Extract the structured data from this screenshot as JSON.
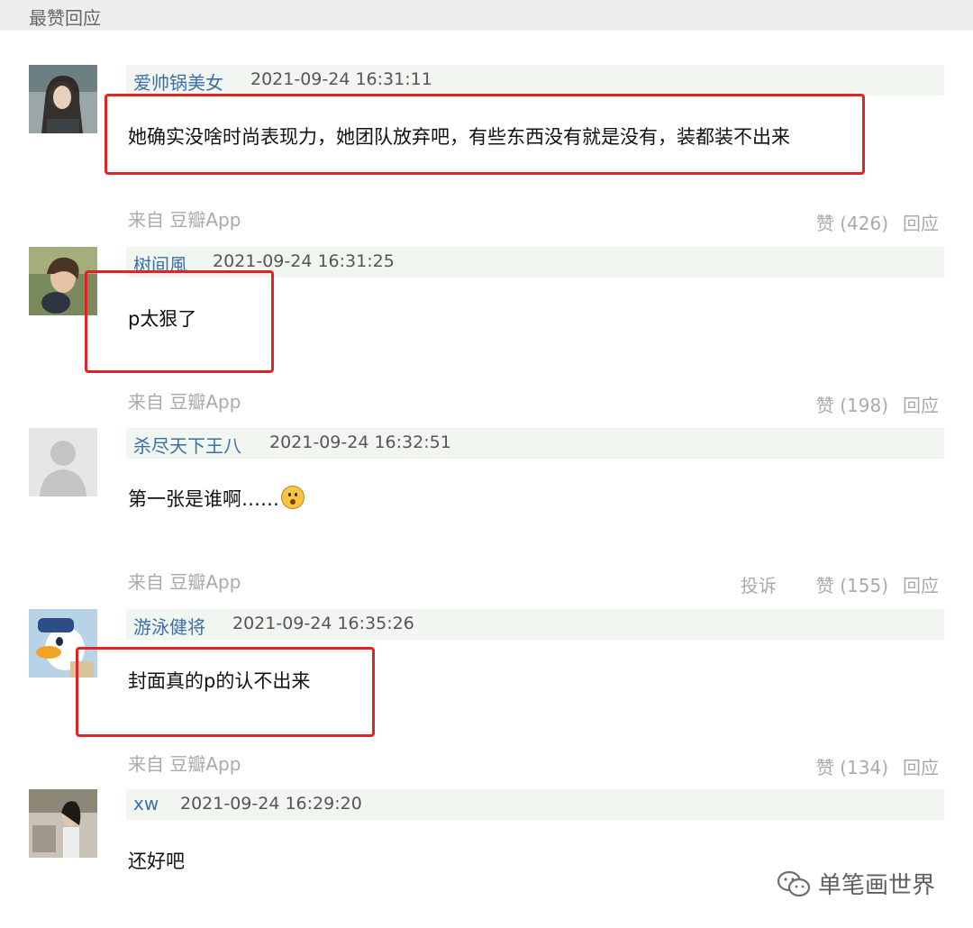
{
  "header": {
    "title": "最赞回应"
  },
  "comments": [
    {
      "author": "爱帅锅美女",
      "time": "2021-09-24 16:31:11",
      "text": "她确实没啥时尚表现力，她团队放弃吧，有些东西没有就是没有，装都装不出来",
      "source": "来自 豆瓣App",
      "like_label": "赞 (426)",
      "reply_label": "回应"
    },
    {
      "author": "树间風",
      "time": "2021-09-24 16:31:25",
      "text": "p太狠了",
      "source": "来自 豆瓣App",
      "like_label": "赞 (198)",
      "reply_label": "回应"
    },
    {
      "author": "杀尽天下王八",
      "time": "2021-09-24 16:32:51",
      "text": "第一张是谁啊……",
      "source": "来自 豆瓣App",
      "report_label": "投诉",
      "like_label": "赞 (155)",
      "reply_label": "回应"
    },
    {
      "author": "游泳健将",
      "time": "2021-09-24 16:35:26",
      "text": "封面真的p的认不出来",
      "source": "来自 豆瓣App",
      "like_label": "赞 (134)",
      "reply_label": "回应"
    },
    {
      "author": "xw",
      "time": "2021-09-24 16:29:20",
      "text": "还好吧"
    }
  ],
  "watermark": {
    "text": "单笔画世界",
    "icon": "wechat-icon"
  },
  "colors": {
    "author": "#3a6fa8",
    "highlight": "#e02424",
    "meta_bg": "#f1f6f1"
  }
}
